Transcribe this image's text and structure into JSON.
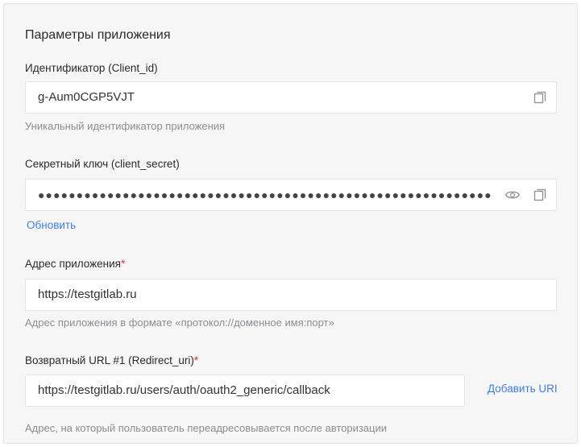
{
  "section": {
    "title": "Параметры приложения"
  },
  "client_id": {
    "label": "Идентификатор (Client_id)",
    "value": "g-Aum0CGP5VJT",
    "hint": "Уникальный идентификатор приложения",
    "copy_icon": "copy-icon"
  },
  "client_secret": {
    "label": "Секретный ключ (client_secret)",
    "masked_value": "●●●●●●●●●●●●●●●●●●●●●●●●●●●●●●●●●●●●●●●●●●●●●●●●●●●●●●●●●●●●●●●●●●●●●●●●",
    "show_icon": "eye-icon",
    "copy_icon": "copy-icon",
    "refresh_label": "Обновить"
  },
  "app_address": {
    "label": "Адрес приложения",
    "required_mark": "*",
    "value": "https://testgitlab.ru",
    "hint": "Адрес приложения в формате «протокол://доменное имя:порт»"
  },
  "redirect_uri": {
    "label": "Возвратный URL #1 (Redirect_uri)",
    "required_mark": "*",
    "value": "https://testgitlab.ru/users/auth/oauth2_generic/callback",
    "add_label": "Добавить URI",
    "hint": "Адрес, на который пользователь переадресовывается после авторизации"
  },
  "colors": {
    "panel_bg": "#f6f6f7",
    "field_bg": "#ffffff",
    "link": "#3f7fd8",
    "required": "#e53935",
    "hint": "#8a8d93"
  }
}
